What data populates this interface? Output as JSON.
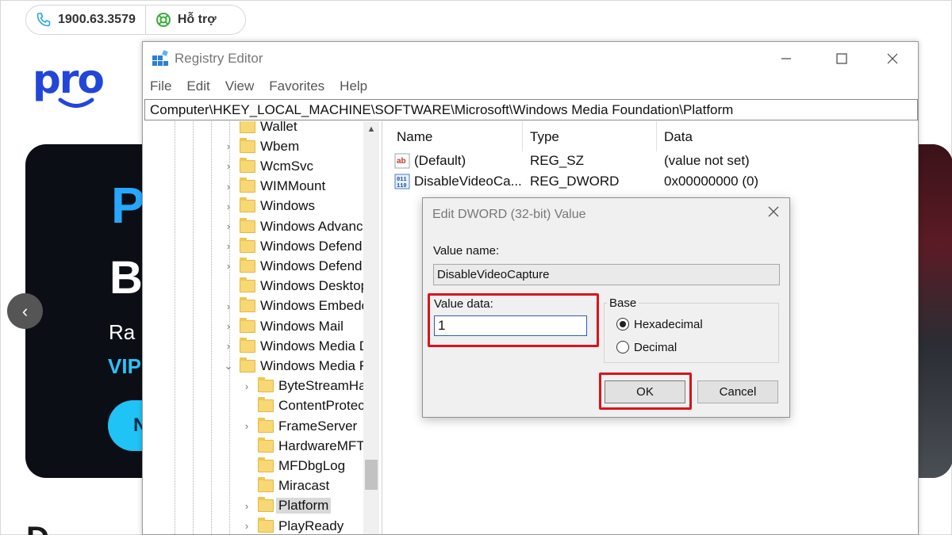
{
  "site": {
    "phone": "1900.63.3579",
    "support": "Hỗ trợ",
    "logo": "pro",
    "banner": {
      "line1": "P",
      "line2": "B",
      "line3": "Ra",
      "line4": "VIP",
      "button": "N"
    },
    "bottom_text": "D",
    "prev_icon": "‹"
  },
  "regedit": {
    "title": "Registry Editor",
    "menu": [
      "File",
      "Edit",
      "View",
      "Favorites",
      "Help"
    ],
    "address": "Computer\\HKEY_LOCAL_MACHINE\\SOFTWARE\\Microsoft\\Windows Media Foundation\\Platform",
    "tree": [
      {
        "label": "Wallet",
        "chevron": ""
      },
      {
        "label": "Wbem",
        "chevron": "›"
      },
      {
        "label": "WcmSvc",
        "chevron": "›"
      },
      {
        "label": "WIMMount",
        "chevron": "›"
      },
      {
        "label": "Windows",
        "chevron": "›"
      },
      {
        "label": "Windows Advanc",
        "chevron": "›"
      },
      {
        "label": "Windows Defend",
        "chevron": "›"
      },
      {
        "label": "Windows Defend",
        "chevron": "›"
      },
      {
        "label": "Windows Desktop",
        "chevron": ""
      },
      {
        "label": "Windows Embedc",
        "chevron": "›"
      },
      {
        "label": "Windows Mail",
        "chevron": "›"
      },
      {
        "label": "Windows Media D",
        "chevron": "›"
      },
      {
        "label": "Windows Media F",
        "chevron": "⌄"
      },
      {
        "label": "ByteStreamHa",
        "chevron": "›"
      },
      {
        "label": "ContentProtec",
        "chevron": ""
      },
      {
        "label": "FrameServer",
        "chevron": "›"
      },
      {
        "label": "HardwareMFT",
        "chevron": ""
      },
      {
        "label": "MFDbgLog",
        "chevron": ""
      },
      {
        "label": "Miracast",
        "chevron": ""
      },
      {
        "label": "Platform",
        "chevron": "›"
      },
      {
        "label": "PlayReady",
        "chevron": "›"
      }
    ],
    "columns": [
      "Name",
      "Type",
      "Data"
    ],
    "values": [
      {
        "name": "(Default)",
        "type": "REG_SZ",
        "data": "(value not set)",
        "icon": "string-value-icon"
      },
      {
        "name": "DisableVideoCa...",
        "type": "REG_DWORD",
        "data": "0x00000000 (0)",
        "icon": "binary-value-icon"
      }
    ]
  },
  "dialog": {
    "title": "Edit DWORD (32-bit) Value",
    "value_name_label": "Value name:",
    "value_name": "DisableVideoCapture",
    "value_data_label": "Value data:",
    "value_data": "1",
    "base_label": "Base",
    "hex_label": "Hexadecimal",
    "dec_label": "Decimal",
    "selected_base": "Hexadecimal",
    "ok_label": "OK",
    "cancel_label": "Cancel",
    "highlight_color": "#d9141c"
  }
}
